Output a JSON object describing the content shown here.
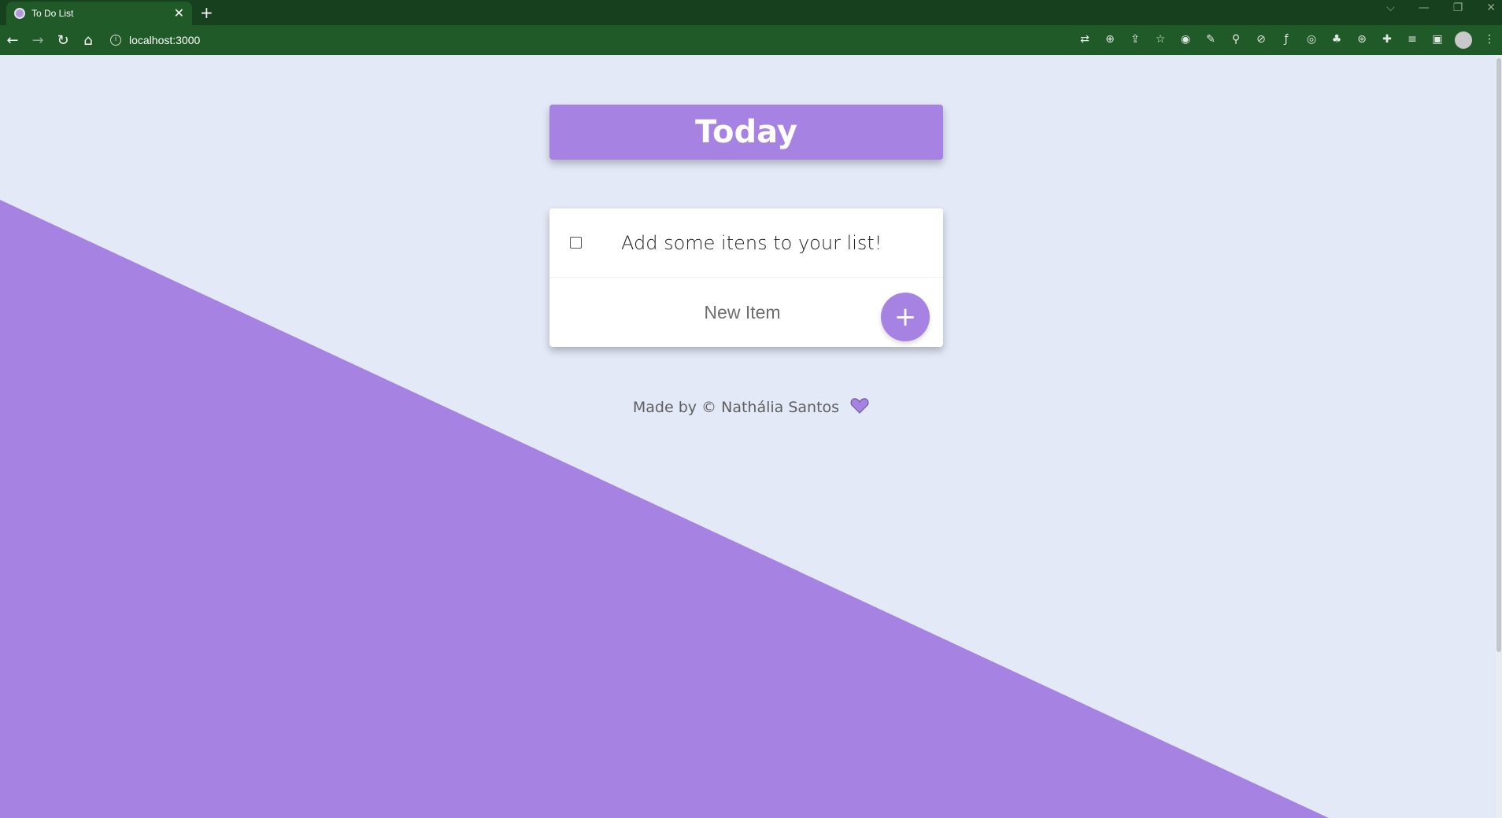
{
  "browser": {
    "tab_title": "To Do List",
    "tab_close": "✕",
    "new_tab": "+",
    "url": "localhost:3000",
    "window_controls": [
      "⌵",
      "—",
      "❐",
      "✕"
    ]
  },
  "page": {
    "heading": "Today",
    "items": [
      {
        "text": "Add some itens to your list!",
        "checked": false
      }
    ],
    "new_item_placeholder": "New Item",
    "add_button_label": "+",
    "footer": "Made by © Nathália Santos"
  },
  "colors": {
    "accent": "#a683e3",
    "background": "#e4e9f7",
    "browser_frame": "#1f5a28"
  },
  "icons": {
    "footer": "heart-icon",
    "checkbox": "checkbox-icon"
  }
}
